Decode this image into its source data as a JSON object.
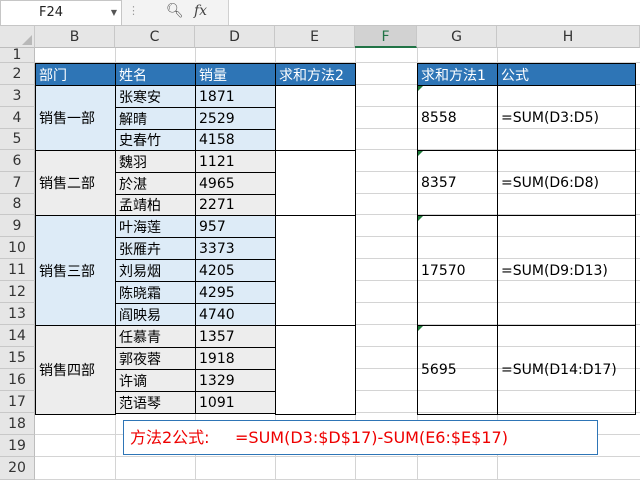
{
  "formula_bar": {
    "name_box": "F24",
    "fx_label": "fx",
    "zoom_icon": "zoom-icon",
    "formula": ""
  },
  "columns": [
    "B",
    "C",
    "D",
    "E",
    "F",
    "G",
    "H"
  ],
  "rows": [
    "1",
    "2",
    "3",
    "4",
    "5",
    "6",
    "7",
    "8",
    "9",
    "10",
    "11",
    "12",
    "13",
    "14",
    "15",
    "16",
    "17",
    "18",
    "19",
    "20"
  ],
  "table1": {
    "headers": [
      "部门",
      "姓名",
      "销量",
      "求和方法2"
    ],
    "departments": [
      "销售一部",
      "销售二部",
      "销售三部",
      "销售四部"
    ],
    "names": [
      "张寒安",
      "解晴",
      "史春竹",
      "魏羽",
      "於湛",
      "孟靖柏",
      "叶海莲",
      "张雁卉",
      "刘易烟",
      "陈晓霜",
      "阎映易",
      "任慕青",
      "郭夜蓉",
      "许谪",
      "范语琴"
    ],
    "sales": [
      "1871",
      "2529",
      "4158",
      "1121",
      "4965",
      "2271",
      "957",
      "3373",
      "4205",
      "4295",
      "4740",
      "1357",
      "1918",
      "1329",
      "1091"
    ]
  },
  "table2": {
    "headers": [
      "求和方法1",
      "公式"
    ],
    "sums": [
      "8558",
      "8357",
      "17570",
      "5695"
    ],
    "formulas": [
      "=SUM(D3:D5)",
      "=SUM(D6:D8)",
      "=SUM(D9:D13)",
      "=SUM(D14:D17)"
    ]
  },
  "note": {
    "label": "方法2公式:",
    "formula": "=SUM(D3:$D$17)-SUM(E6:$E$17)"
  }
}
